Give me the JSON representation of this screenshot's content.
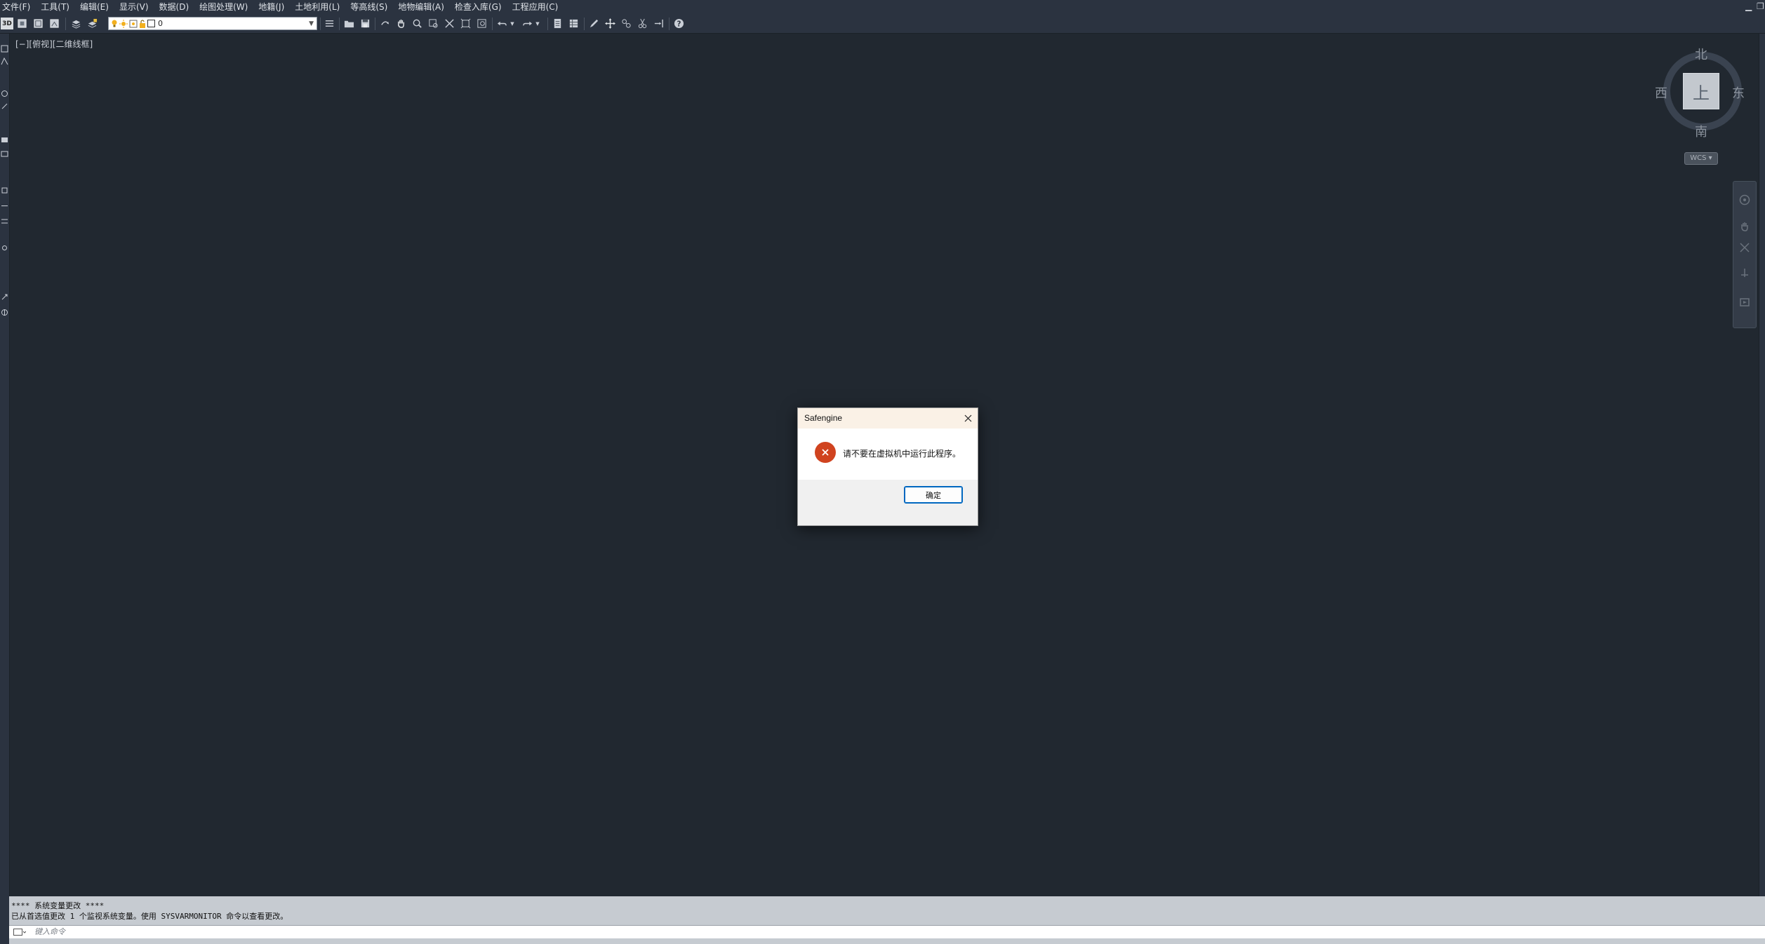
{
  "menubar": {
    "items": [
      "文件(F)",
      "工具(T)",
      "编辑(E)",
      "显示(V)",
      "数据(D)",
      "绘图处理(W)",
      "地籍(J)",
      "土地利用(L)",
      "等高线(S)",
      "地物编辑(A)",
      "检查入库(G)",
      "工程应用(C)"
    ]
  },
  "toolbar": {
    "view3d_label": "3D",
    "layer_name": "0"
  },
  "viewport": {
    "label": "[−][俯视][二维线框]"
  },
  "viewcube": {
    "north": "北",
    "south": "南",
    "east": "东",
    "west": "西",
    "face": "上",
    "wcs": "WCS"
  },
  "dialog": {
    "title": "Safengine",
    "message": "请不要在虚拟机中运行此程序。",
    "ok_label": "确定"
  },
  "command_line": {
    "history_line1": "**** 系统变量更改 ****",
    "history_line2": "已从首选值更改 1 个监视系统变量。使用 SYSVARMONITOR 命令以查看更改。",
    "input_placeholder": "键入命令"
  },
  "colors": {
    "canvas_bg": "#212830",
    "chrome_bg": "#2b3340",
    "error_red": "#d0431f",
    "accent_blue": "#0067c0"
  }
}
